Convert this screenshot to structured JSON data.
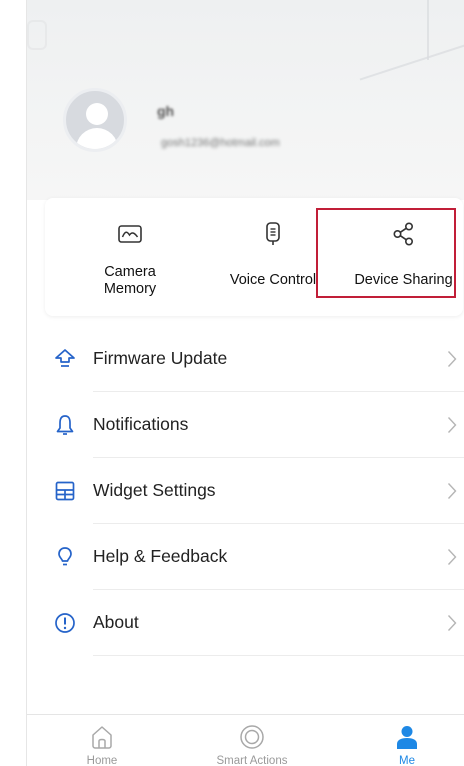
{
  "profile": {
    "name": "gh",
    "email": "gosh1236@hotmail.com"
  },
  "quick_actions": [
    {
      "label": "Camera\nMemory",
      "icon": "camera-memory-icon"
    },
    {
      "label": "Voice Control",
      "icon": "voice-control-icon"
    },
    {
      "label": "Device Sharing",
      "icon": "share-icon",
      "highlighted": true
    }
  ],
  "menu": [
    {
      "label": "Firmware Update",
      "icon": "firmware-update-icon"
    },
    {
      "label": "Notifications",
      "icon": "bell-icon"
    },
    {
      "label": "Widget Settings",
      "icon": "widget-icon"
    },
    {
      "label": "Help & Feedback",
      "icon": "lightbulb-icon"
    },
    {
      "label": "About",
      "icon": "info-icon"
    }
  ],
  "tabs": [
    {
      "label": "Home",
      "icon": "home-icon",
      "active": false
    },
    {
      "label": "Smart Actions",
      "icon": "smart-actions-icon",
      "active": false
    },
    {
      "label": "Me",
      "icon": "person-icon",
      "active": true
    }
  ],
  "colors": {
    "accent": "#1e88e5",
    "highlight_border": "#c11e38",
    "icon_blue": "#2563c9"
  }
}
